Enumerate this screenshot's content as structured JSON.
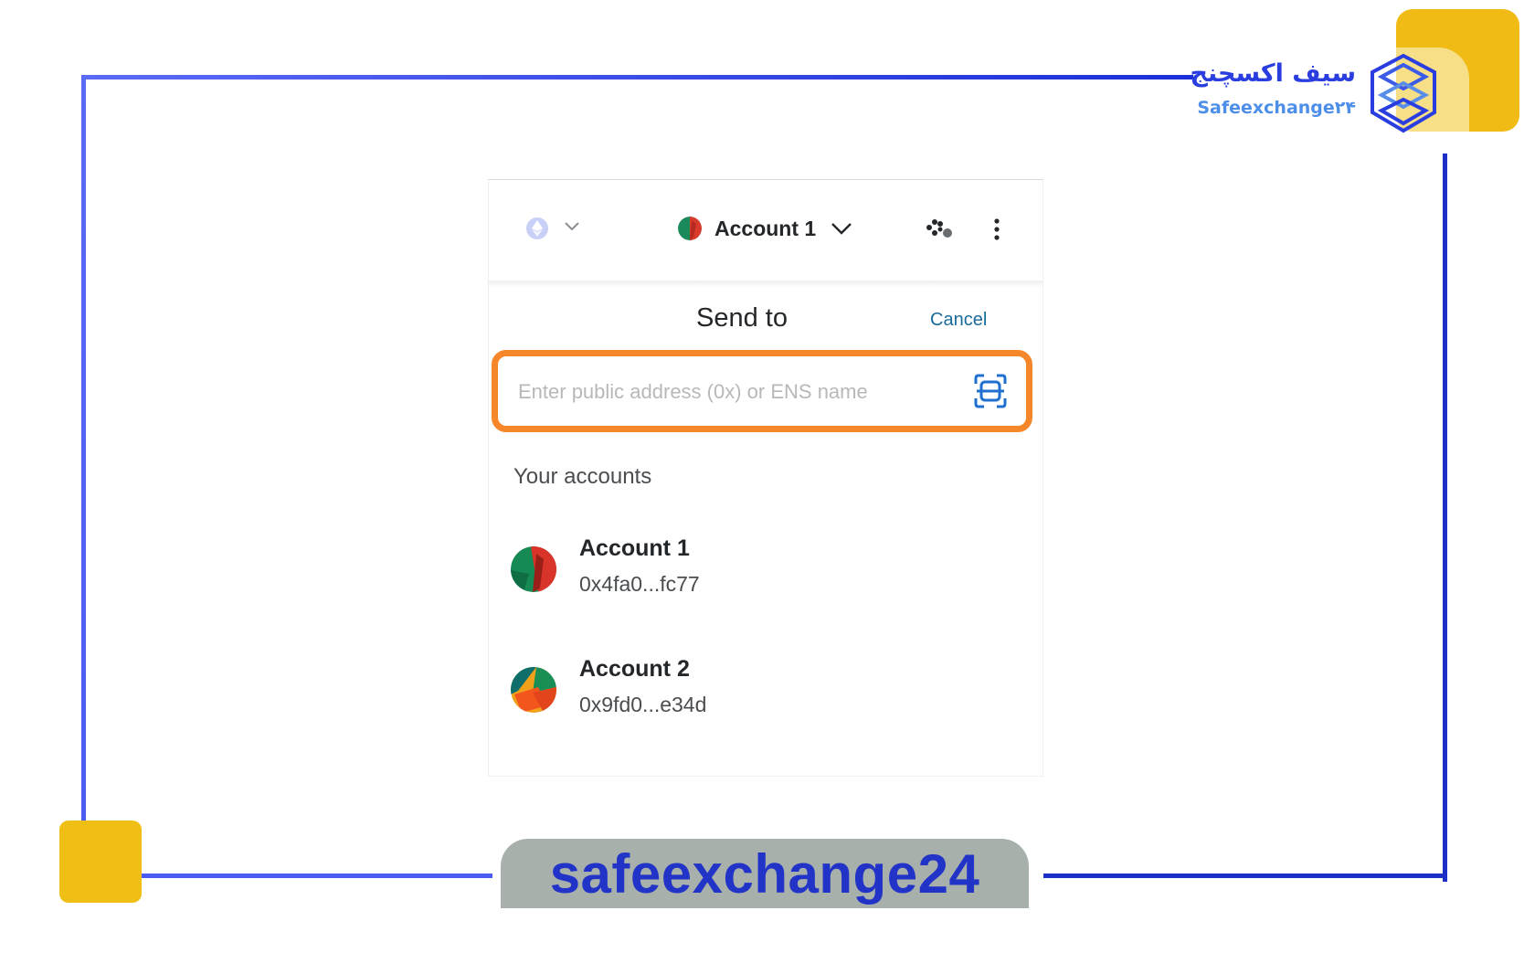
{
  "brand": {
    "name_fa": "سیف اکسچنج",
    "name_en": "Safeexchange۲۴",
    "banner": "safeexchange24",
    "colors": {
      "frame_blue": "#4a5cf2",
      "accent_yellow": "#f0bf16",
      "highlight_orange": "#f5862a"
    }
  },
  "header": {
    "network_icon": "ethereum-network-icon",
    "account_label": "Account 1",
    "connected_sites_icon": "connected-sites-icon",
    "menu_icon": "kebab-menu-icon"
  },
  "send": {
    "title": "Send to",
    "cancel_label": "Cancel",
    "input_placeholder": "Enter public address (0x) or ENS name",
    "input_value": "",
    "scan_icon": "qr-scan-icon"
  },
  "accounts": {
    "section_label": "Your accounts",
    "items": [
      {
        "name": "Account 1",
        "address": "0x4fa0...fc77"
      },
      {
        "name": "Account 2",
        "address": "0x9fd0...e34d"
      }
    ]
  }
}
